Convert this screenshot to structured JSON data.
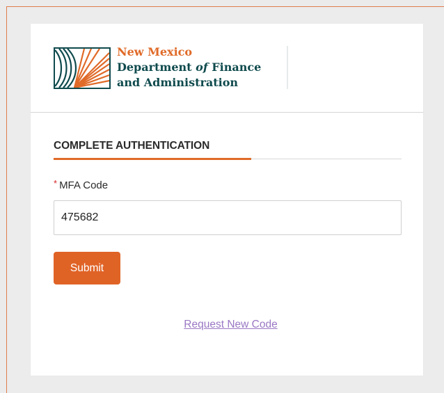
{
  "brand": {
    "line1": "New Mexico",
    "line2_prefix": "Department ",
    "line2_em": "of",
    "line2_suffix": " Finance",
    "line3": "and Administration",
    "colors": {
      "orange": "#e06a28",
      "teal": "#0f4a4d"
    }
  },
  "form": {
    "section_title": "COMPLETE AUTHENTICATION",
    "required_marker": "*",
    "mfa_label": "MFA Code",
    "mfa_value": "475682",
    "submit_label": "Submit",
    "request_link": "Request New Code"
  },
  "colors": {
    "accent": "#e06326",
    "link": "#9a78c4",
    "required": "#d6262a"
  },
  "icons": {
    "logo": "nm-dfa-sunburst-logo"
  }
}
